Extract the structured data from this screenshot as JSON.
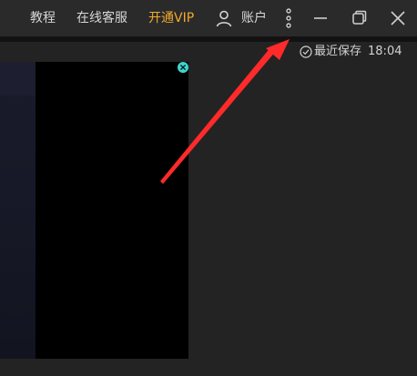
{
  "titlebar": {
    "menu": {
      "tutorial": "教程",
      "support": "在线客服",
      "vip": "开通VIP",
      "account": "账户"
    },
    "icons": {
      "account": "user-icon",
      "more": "more-vertical-icon",
      "minimize": "minimize-icon",
      "restore": "restore-window-icon",
      "close": "close-icon"
    }
  },
  "status": {
    "label": "最近保存",
    "time": "18:04",
    "icon": "check-circle-icon"
  },
  "canvas": {
    "close_icon": "close-icon",
    "accent": "#3dd6d0"
  },
  "colors": {
    "vip": "#f1a92e",
    "annotation": "#ff2a2a"
  }
}
